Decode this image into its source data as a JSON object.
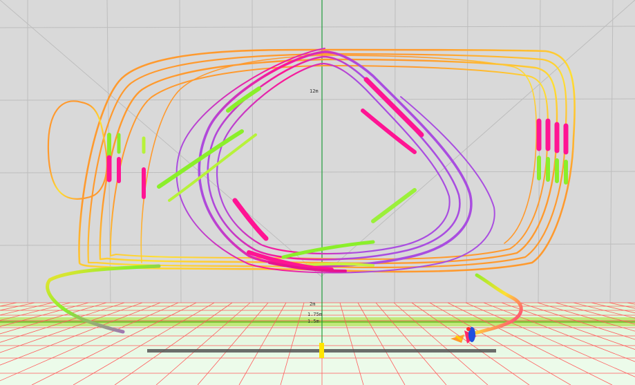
{
  "scene": {
    "background_color": "#d9d9d9",
    "floor_color": "#e8fbe8",
    "floor_grid_color": "#ff4d4d",
    "vertical_axis_color": "#1e9b3a"
  },
  "ruler": {
    "marks": [
      "2m",
      "1.75m",
      "1.5m"
    ],
    "upper_mark": "12m"
  },
  "trajectory": {
    "gradient_colors": [
      "#a94de0",
      "#ff1493",
      "#ffe033",
      "#8aef2a",
      "#ff9a2e"
    ],
    "drone_icon": "quadcopter-icon"
  }
}
